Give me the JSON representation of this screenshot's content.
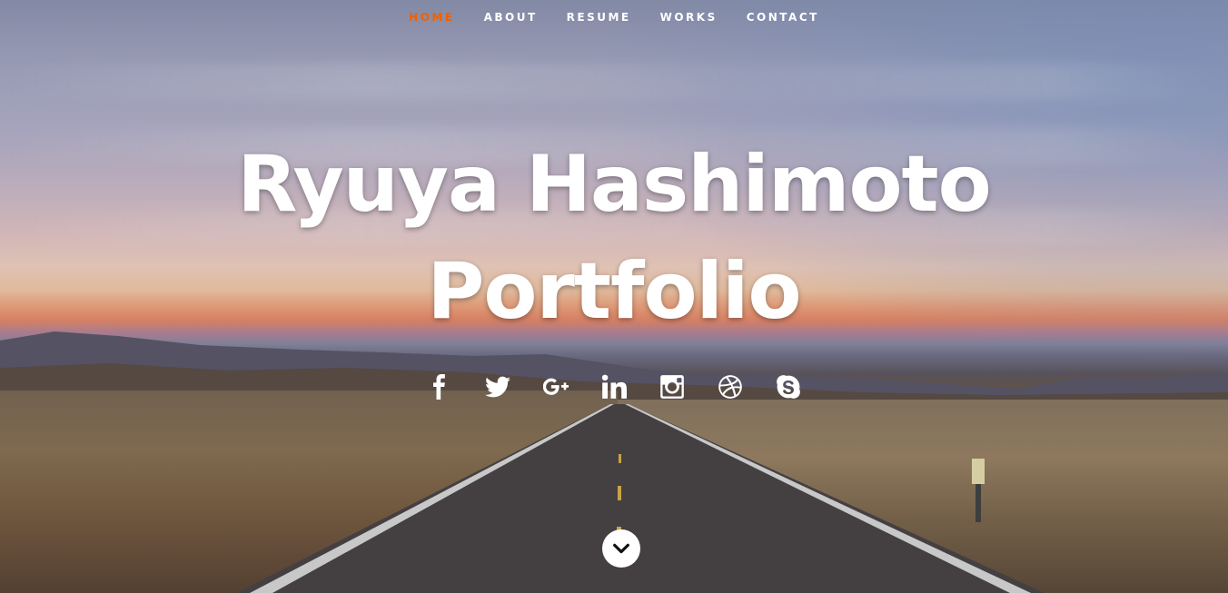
{
  "nav": {
    "items": [
      {
        "label": "HOME",
        "active": true
      },
      {
        "label": "ABOUT",
        "active": false
      },
      {
        "label": "RESUME",
        "active": false
      },
      {
        "label": "WORKS",
        "active": false
      },
      {
        "label": "CONTACT",
        "active": false
      }
    ],
    "active_color": "#f06000"
  },
  "hero": {
    "title_line1": "Ryuya Hashimoto",
    "title_line2": "Portfolio"
  },
  "social": {
    "icons": [
      "facebook-icon",
      "twitter-icon",
      "google-plus-icon",
      "linkedin-icon",
      "instagram-icon",
      "dribbble-icon",
      "skype-icon"
    ]
  },
  "scroll": {
    "icon": "chevron-down-icon"
  }
}
